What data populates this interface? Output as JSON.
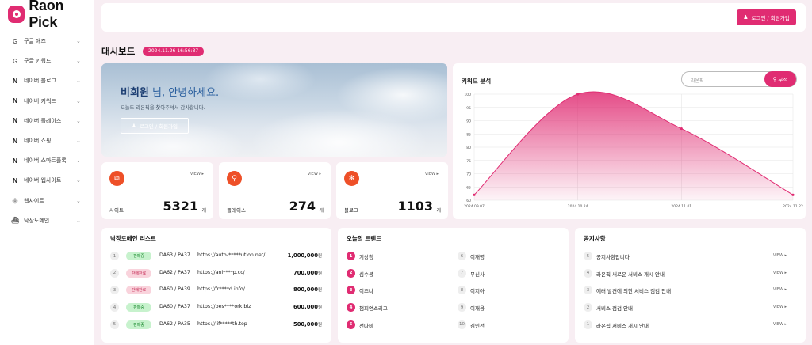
{
  "app": {
    "name": "Raon Pick"
  },
  "sidebar": {
    "items": [
      {
        "icon": "google-icon",
        "glyph": "G",
        "label": "구글 애즈"
      },
      {
        "icon": "google-icon",
        "glyph": "G",
        "label": "구글 키워드"
      },
      {
        "icon": "naver-icon",
        "glyph": "N",
        "label": "네이버 블로그"
      },
      {
        "icon": "naver-icon",
        "glyph": "N",
        "label": "네이버 키워드"
      },
      {
        "icon": "naver-icon",
        "glyph": "N",
        "label": "네이버 플레이스"
      },
      {
        "icon": "naver-icon",
        "glyph": "N",
        "label": "네이버 쇼핑"
      },
      {
        "icon": "naver-icon",
        "glyph": "N",
        "label": "네이버 스마트플록"
      },
      {
        "icon": "naver-icon",
        "glyph": "N",
        "label": "네이버 웹사이트"
      },
      {
        "icon": "globe-icon",
        "glyph": "◎",
        "label": "웹사이트"
      },
      {
        "icon": "ship-icon",
        "glyph": "⛴",
        "label": "낙장도메인"
      }
    ]
  },
  "header": {
    "login_label": "로그인 / 회원가입"
  },
  "dashboard": {
    "title": "대시보드",
    "timestamp": "2024.11.26 16:56:37"
  },
  "hero": {
    "name": "비회원",
    "greeting_suffix": " 님, 안녕하세요.",
    "subtitle": "오늘도 라온픽을 찾아주셔서 감사합니다.",
    "button_label": "로그인 / 회원가입"
  },
  "stats": [
    {
      "label": "사이트",
      "value": "5321",
      "unit": "개",
      "view": "VIEW ▸",
      "icon": "site-icon"
    },
    {
      "label": "플레이스",
      "value": "274",
      "unit": "개",
      "view": "VIEW ▸",
      "icon": "place-icon"
    },
    {
      "label": "블로그",
      "value": "1103",
      "unit": "개",
      "view": "VIEW ▸",
      "icon": "blog-icon"
    }
  ],
  "keyword": {
    "title": "키워드 분석",
    "placeholder": "라온픽",
    "button_label": "분석"
  },
  "chart_data": {
    "type": "area",
    "x": [
      "2024.09.07",
      "2024.10.24",
      "2024.11.01",
      "2024.11.22"
    ],
    "values": [
      62,
      100,
      87,
      62
    ],
    "ylim": [
      60,
      100
    ],
    "yticks": [
      60,
      65,
      70,
      75,
      80,
      85,
      90,
      95,
      100
    ],
    "grid": true,
    "color": "#e02c72"
  },
  "domains": {
    "title": "낙장도메인 리스트",
    "rows": [
      {
        "rank": "1",
        "status": "판매중",
        "status_type": "sale",
        "da": "DA63 / PA37",
        "url": "https://auto-*****ution.net/",
        "price": "1,000,000",
        "unit": "원"
      },
      {
        "rank": "2",
        "status": "판매완료",
        "status_type": "done",
        "da": "DA62 / PA37",
        "url": "https://ani****p.cc/",
        "price": "700,000",
        "unit": "원"
      },
      {
        "rank": "3",
        "status": "판매완료",
        "status_type": "done",
        "da": "DA60 / PA39",
        "url": "https://fr****d.info/",
        "price": "800,000",
        "unit": "원"
      },
      {
        "rank": "4",
        "status": "판매중",
        "status_type": "sale",
        "da": "DA60 / PA37",
        "url": "https://bes****ork.biz",
        "price": "600,000",
        "unit": "원"
      },
      {
        "rank": "5",
        "status": "판매중",
        "status_type": "sale",
        "da": "DA62 / PA35",
        "url": "https://lif*****th.top",
        "price": "500,000",
        "unit": "원"
      }
    ]
  },
  "trends": {
    "title": "오늘의 트렌드",
    "left": [
      {
        "rank": "1",
        "text": "기상청"
      },
      {
        "rank": "2",
        "text": "심수봉"
      },
      {
        "rank": "3",
        "text": "이즈나"
      },
      {
        "rank": "4",
        "text": "챔피언스리그"
      },
      {
        "rank": "5",
        "text": "전나비"
      }
    ],
    "right": [
      {
        "rank": "6",
        "text": "이재명"
      },
      {
        "rank": "7",
        "text": "무신사"
      },
      {
        "rank": "8",
        "text": "이지아"
      },
      {
        "rank": "9",
        "text": "이재용"
      },
      {
        "rank": "10",
        "text": "김민전"
      }
    ]
  },
  "notices": {
    "title": "공지사항",
    "view_label": "VIEW ▸",
    "rows": [
      {
        "rank": "5",
        "text": "공지사항입니다"
      },
      {
        "rank": "4",
        "text": "라온픽 새로운 서비스 개시 안내"
      },
      {
        "rank": "3",
        "text": "에러 발견에 의한 서비스 점검 안내"
      },
      {
        "rank": "2",
        "text": "서비스 점검 안내"
      },
      {
        "rank": "1",
        "text": "라온픽 서비스 개시 안내"
      }
    ]
  }
}
